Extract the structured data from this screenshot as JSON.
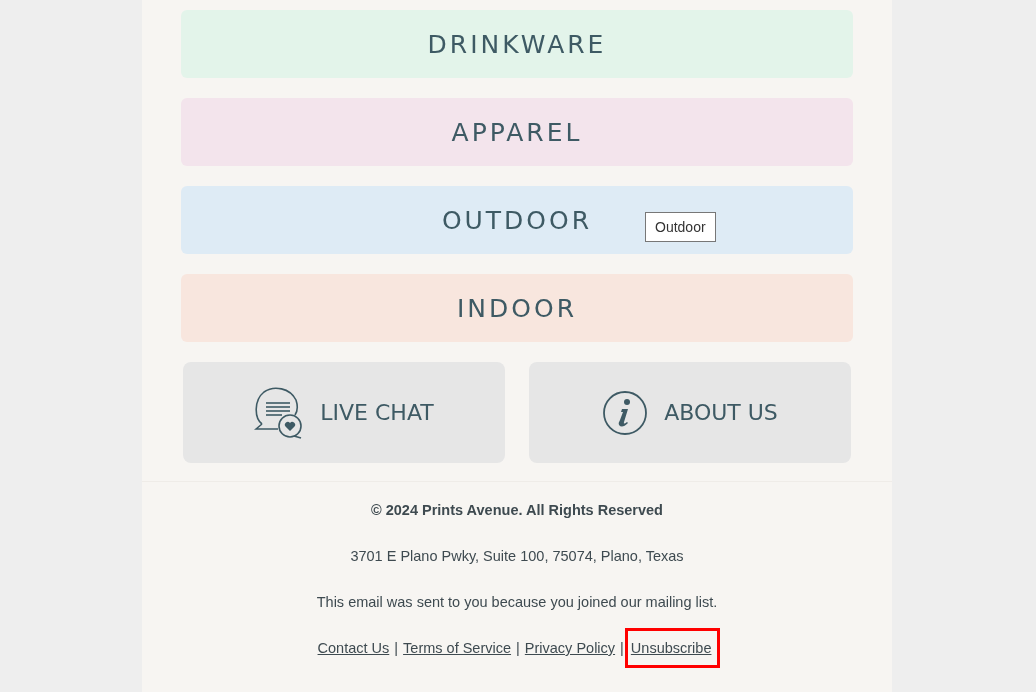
{
  "categories": [
    {
      "label": "DRINKWARE",
      "color": "#e3f4ea"
    },
    {
      "label": "APPAREL",
      "color": "#f3e4ec"
    },
    {
      "label": "OUTDOOR",
      "color": "#deebf5",
      "tooltip": "Outdoor"
    },
    {
      "label": "INDOOR",
      "color": "#f8e6de"
    }
  ],
  "tiles": [
    {
      "kind": "chat",
      "label": "LIVE CHAT"
    },
    {
      "kind": "info",
      "label": "ABOUT US"
    }
  ],
  "footer": {
    "copyright": "© 2024 Prints Avenue. All Rights Reserved",
    "address": "3701 E Plano Pwky, Suite 100, 75074, Plano, Texas",
    "notice": "This email was sent to you because you joined our mailing list.",
    "separator": "|",
    "links": [
      {
        "label": "Contact Us",
        "highlighted": false
      },
      {
        "label": "Terms of Service",
        "highlighted": false
      },
      {
        "label": "Privacy Policy",
        "highlighted": false
      },
      {
        "label": "Unsubscribe",
        "highlighted": true
      }
    ]
  }
}
